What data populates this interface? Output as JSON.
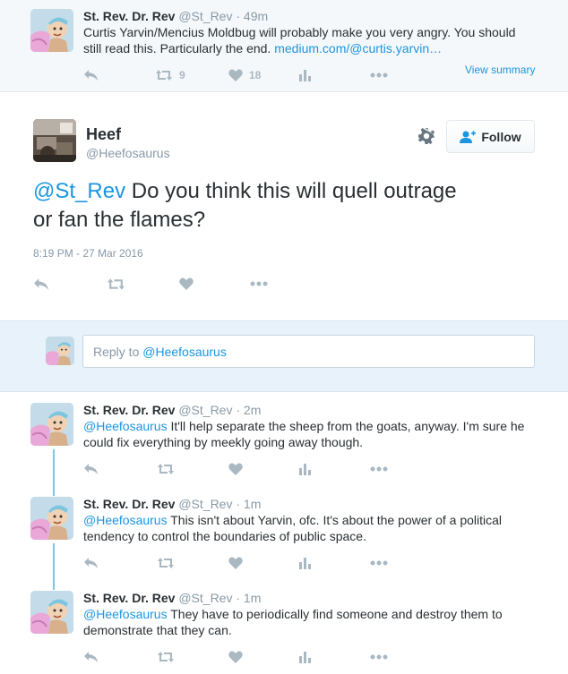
{
  "parent_tweet": {
    "name": "St. Rev. Dr. Rev",
    "handle": "@St_Rev",
    "sep": "·",
    "time": "49m",
    "text_line1": "Curtis Yarvin/Mencius Moldbug will probably make you very angry. You should",
    "text_line2_plain": "still read this. Particularly the end. ",
    "link": "medium.com/@curtis.yarvin…",
    "retweet_count": "9",
    "like_count": "18",
    "view_summary": "View summary"
  },
  "main_tweet": {
    "name": "Heef",
    "handle": "@Heefosaurus",
    "follow_label": "Follow",
    "mention": "@St_Rev",
    "text_part1": " Do you think this will quell outrage",
    "text_line2": "or fan the flames?",
    "timestamp": "8:19 PM - 27 Mar 2016"
  },
  "reply_box": {
    "placeholder_prefix": "Reply to ",
    "placeholder_mention": "@Heefosaurus"
  },
  "replies": [
    {
      "name": "St. Rev. Dr. Rev",
      "handle": "@St_Rev",
      "sep": "·",
      "time": "2m",
      "mention": "@Heefosaurus",
      "line1": " It'll help separate the sheep from the goats, anyway. I'm sure he",
      "line2": "could fix everything by meekly going away though."
    },
    {
      "name": "St. Rev. Dr. Rev",
      "handle": "@St_Rev",
      "sep": "·",
      "time": "1m",
      "mention": "@Heefosaurus",
      "line1": " This isn't about Yarvin, ofc. It's about the power of a political",
      "line2": "tendency to control the boundaries of public space."
    },
    {
      "name": "St. Rev. Dr. Rev",
      "handle": "@St_Rev",
      "sep": "·",
      "time": "1m",
      "mention": "@Heefosaurus",
      "line1": " They have to periodically find someone and destroy them to",
      "line2": "demonstrate that they can."
    }
  ],
  "colors": {
    "link": "#1b95e0",
    "muted": "#8899a6",
    "icon": "#aab8c2",
    "text": "#292f33",
    "connector": "#7cc4e8"
  },
  "icons": [
    "reply-icon",
    "retweet-icon",
    "like-icon",
    "analytics-icon",
    "more-icon",
    "gear-icon",
    "follow-person-icon"
  ]
}
